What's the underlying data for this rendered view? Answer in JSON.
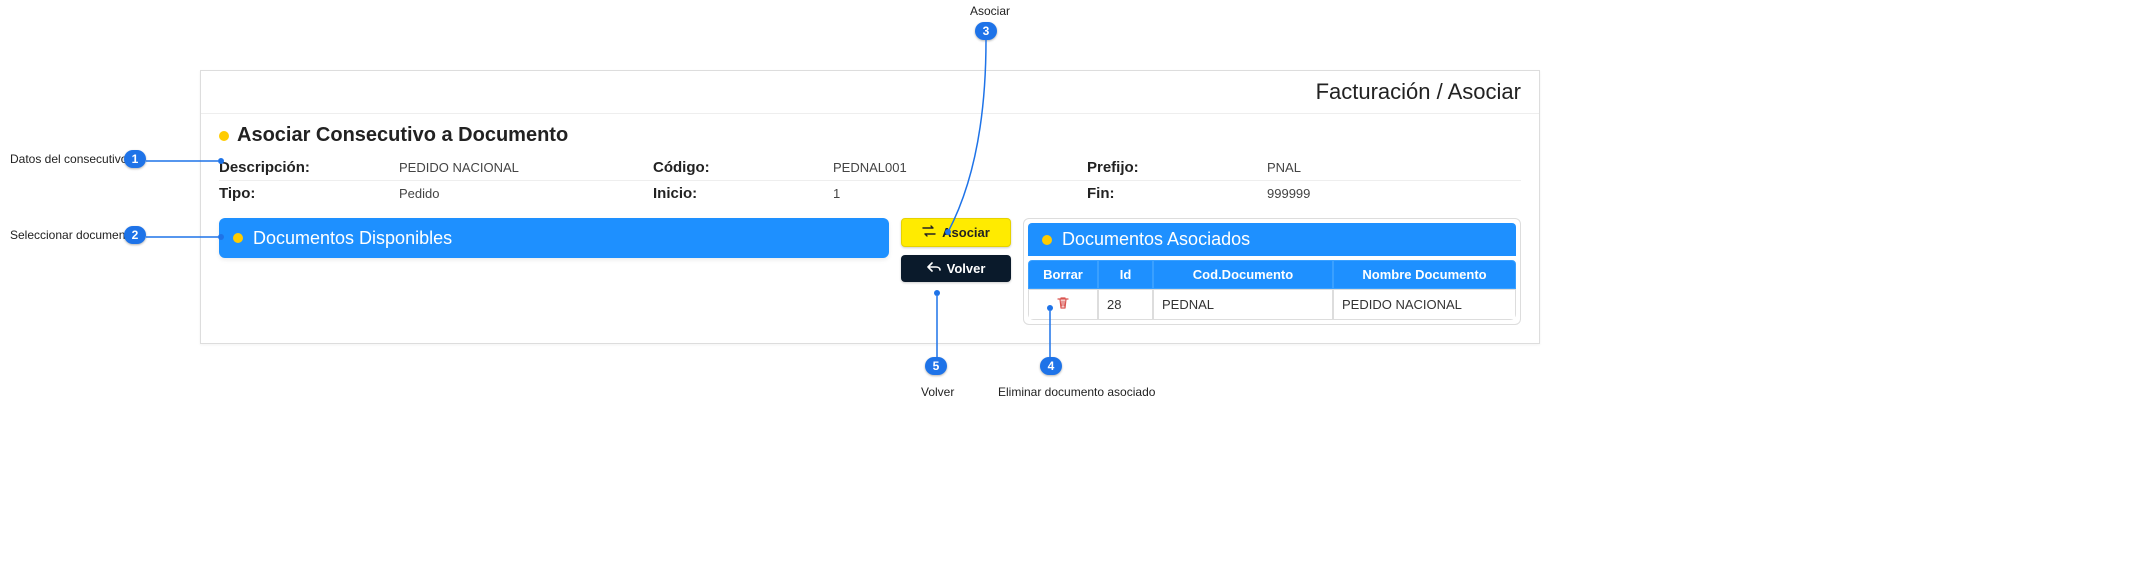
{
  "header": {
    "breadcrumb": "Facturación / Asociar"
  },
  "section": {
    "title": "Asociar Consecutivo a Documento"
  },
  "info": {
    "descripcion_label": "Descripción:",
    "descripcion_value": "PEDIDO NACIONAL",
    "codigo_label": "Código:",
    "codigo_value": "PEDNAL001",
    "prefijo_label": "Prefijo:",
    "prefijo_value": "PNAL",
    "tipo_label": "Tipo:",
    "tipo_value": "Pedido",
    "inicio_label": "Inicio:",
    "inicio_value": "1",
    "fin_label": "Fin:",
    "fin_value": "999999"
  },
  "left_panel": {
    "title": "Documentos Disponibles"
  },
  "buttons": {
    "asociar": "Asociar",
    "volver": "Volver"
  },
  "right_panel": {
    "title": "Documentos Asociados",
    "columns": {
      "borrar": "Borrar",
      "id": "Id",
      "cod": "Cod.Documento",
      "nombre": "Nombre Documento"
    },
    "row": {
      "id": "28",
      "cod": "PEDNAL",
      "nombre": "PEDIDO NACIONAL"
    }
  },
  "callouts": {
    "c1": {
      "num": "1",
      "label": "Datos del consecutivo"
    },
    "c2": {
      "num": "2",
      "label": "Seleccionar documento"
    },
    "c3": {
      "num": "3",
      "label": "Asociar"
    },
    "c4": {
      "num": "4",
      "label": "Eliminar documento asociado"
    },
    "c5": {
      "num": "5",
      "label": "Volver"
    }
  }
}
